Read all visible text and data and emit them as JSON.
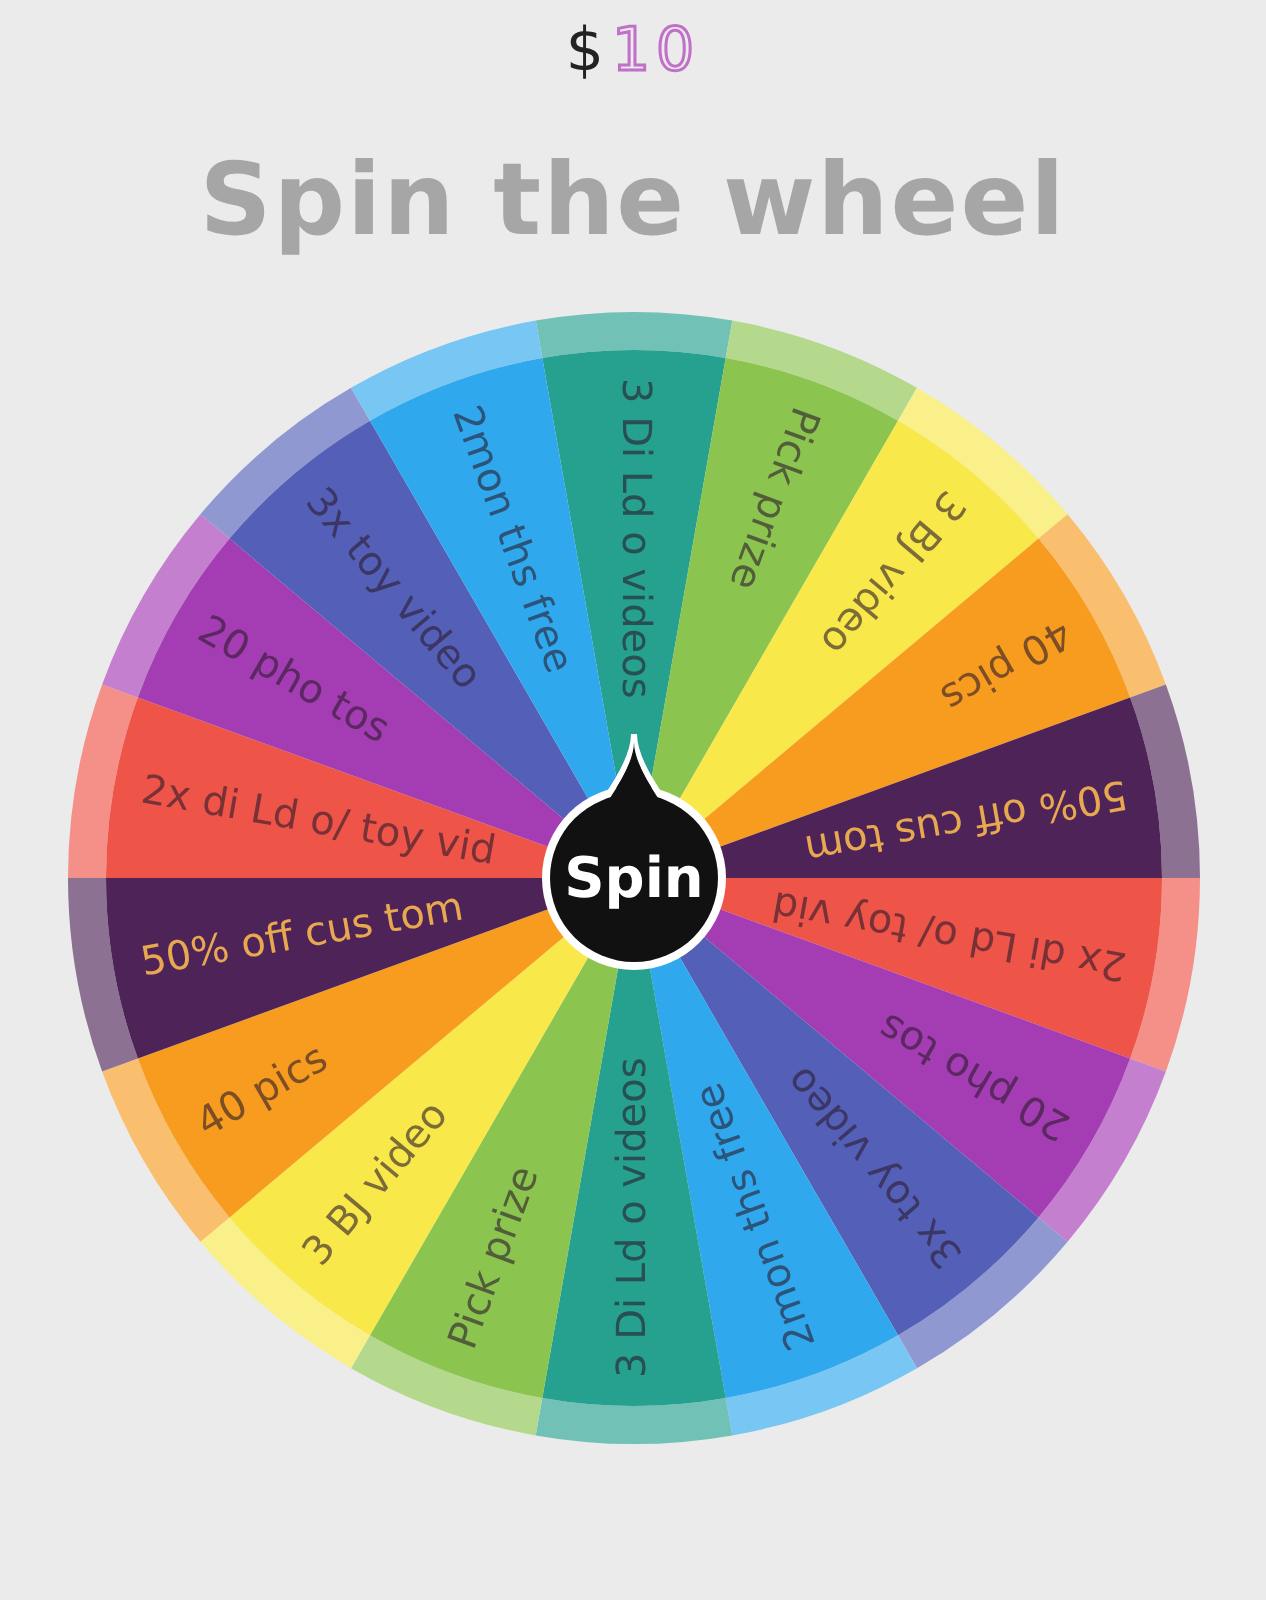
{
  "balance": {
    "currency": "$",
    "amount": "10"
  },
  "title": "Spin the wheel",
  "wheel": {
    "segments": [
      {
        "label": "3 Di Ld o videos",
        "color": "#26a08f"
      },
      {
        "label": "Pick prize",
        "color": "#8cc450"
      },
      {
        "label": "3 BJ video",
        "color": "#f8e84a"
      },
      {
        "label": "40 pics",
        "color": "#f89c20"
      },
      {
        "label": "50% off cus tom",
        "color": "#4e2458"
      },
      {
        "label": "2x di Ld o/ toy vid",
        "color": "#ee5448"
      },
      {
        "label": "20 pho tos",
        "color": "#a43cb4"
      },
      {
        "label": "3x toy video",
        "color": "#5460b8"
      },
      {
        "label": "2mon ths free",
        "color": "#30a8ee"
      },
      {
        "label": "3 Di Ld o videos",
        "color": "#26a08f"
      },
      {
        "label": "Pick prize",
        "color": "#8cc450"
      },
      {
        "label": "3 BJ video",
        "color": "#f8e84a"
      },
      {
        "label": "40 pics",
        "color": "#f89c20"
      },
      {
        "label": "50% off cus tom",
        "color": "#4e2458"
      },
      {
        "label": "2x di Ld o/ toy vid",
        "color": "#ee5448"
      },
      {
        "label": "20 pho tos",
        "color": "#a43cb4"
      },
      {
        "label": "3x toy video",
        "color": "#5460b8"
      },
      {
        "label": "2mon ths free",
        "color": "#30a8ee"
      }
    ],
    "button": "Spin"
  }
}
